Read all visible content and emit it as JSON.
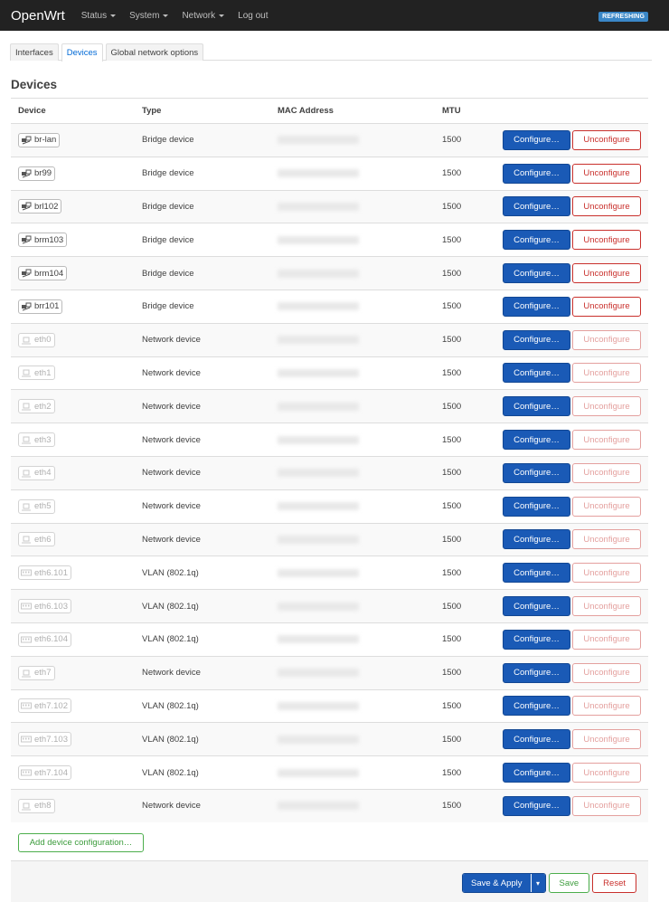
{
  "brand": "OpenWrt",
  "menu": [
    {
      "label": "Status",
      "caret": true
    },
    {
      "label": "System",
      "caret": true
    },
    {
      "label": "Network",
      "caret": true
    },
    {
      "label": "Log out",
      "caret": false
    }
  ],
  "status_badge": "REFRESHING",
  "tabs": [
    {
      "label": "Interfaces",
      "active": false
    },
    {
      "label": "Devices",
      "active": true
    },
    {
      "label": "Global network options",
      "active": false
    }
  ],
  "section_title": "Devices",
  "columns": {
    "device": "Device",
    "type": "Type",
    "mac": "MAC Address",
    "mtu": "MTU"
  },
  "actions": {
    "configure": "Configure…",
    "unconfigure": "Unconfigure"
  },
  "devices": [
    {
      "name": "br-lan",
      "type": "Bridge device",
      "mtu": "1500",
      "icon": "bridge-icon",
      "configured": true
    },
    {
      "name": "br99",
      "type": "Bridge device",
      "mtu": "1500",
      "icon": "bridge-icon",
      "configured": true
    },
    {
      "name": "brl102",
      "type": "Bridge device",
      "mtu": "1500",
      "icon": "bridge-icon",
      "configured": true
    },
    {
      "name": "brm103",
      "type": "Bridge device",
      "mtu": "1500",
      "icon": "bridge-icon",
      "configured": true
    },
    {
      "name": "brm104",
      "type": "Bridge device",
      "mtu": "1500",
      "icon": "bridge-icon",
      "configured": true
    },
    {
      "name": "brr101",
      "type": "Bridge device",
      "mtu": "1500",
      "icon": "bridge-icon",
      "configured": true
    },
    {
      "name": "eth0",
      "type": "Network device",
      "mtu": "1500",
      "icon": "ethernet-icon",
      "configured": false
    },
    {
      "name": "eth1",
      "type": "Network device",
      "mtu": "1500",
      "icon": "ethernet-icon",
      "configured": false
    },
    {
      "name": "eth2",
      "type": "Network device",
      "mtu": "1500",
      "icon": "ethernet-icon",
      "configured": false
    },
    {
      "name": "eth3",
      "type": "Network device",
      "mtu": "1500",
      "icon": "ethernet-icon",
      "configured": false
    },
    {
      "name": "eth4",
      "type": "Network device",
      "mtu": "1500",
      "icon": "ethernet-icon",
      "configured": false
    },
    {
      "name": "eth5",
      "type": "Network device",
      "mtu": "1500",
      "icon": "ethernet-icon",
      "configured": false
    },
    {
      "name": "eth6",
      "type": "Network device",
      "mtu": "1500",
      "icon": "ethernet-icon",
      "configured": false
    },
    {
      "name": "eth6.101",
      "type": "VLAN (802.1q)",
      "mtu": "1500",
      "icon": "vlan-icon",
      "configured": false
    },
    {
      "name": "eth6.103",
      "type": "VLAN (802.1q)",
      "mtu": "1500",
      "icon": "vlan-icon",
      "configured": false
    },
    {
      "name": "eth6.104",
      "type": "VLAN (802.1q)",
      "mtu": "1500",
      "icon": "vlan-icon",
      "configured": false
    },
    {
      "name": "eth7",
      "type": "Network device",
      "mtu": "1500",
      "icon": "ethernet-icon",
      "configured": false
    },
    {
      "name": "eth7.102",
      "type": "VLAN (802.1q)",
      "mtu": "1500",
      "icon": "vlan-icon",
      "configured": false
    },
    {
      "name": "eth7.103",
      "type": "VLAN (802.1q)",
      "mtu": "1500",
      "icon": "vlan-icon",
      "configured": false
    },
    {
      "name": "eth7.104",
      "type": "VLAN (802.1q)",
      "mtu": "1500",
      "icon": "vlan-icon",
      "configured": false
    },
    {
      "name": "eth8",
      "type": "Network device",
      "mtu": "1500",
      "icon": "ethernet-icon",
      "configured": false
    }
  ],
  "add_button": "Add device configuration…",
  "footer": {
    "apply": "Save & Apply",
    "apply_menu": "▾",
    "save": "Save",
    "reset": "Reset"
  },
  "colors": {
    "primary": "#1a5ab6",
    "danger": "#c9302c",
    "success": "#4cae4c",
    "navbar": "#222222",
    "link": "#0069d6"
  }
}
